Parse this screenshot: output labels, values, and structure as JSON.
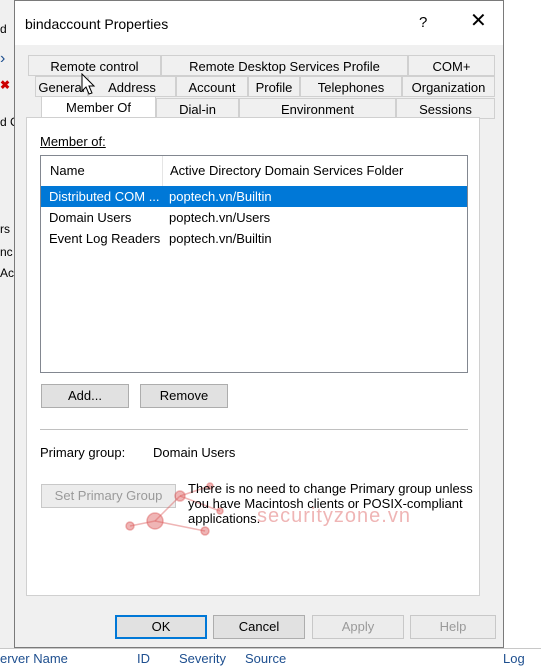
{
  "dialog": {
    "title": "bindaccount Properties",
    "help_glyph": "?",
    "close_glyph": "✕"
  },
  "tabs": {
    "row1": [
      "Remote control",
      "Remote Desktop Services Profile",
      "COM+"
    ],
    "row2": [
      "General",
      "Address",
      "Account",
      "Profile",
      "Telephones",
      "Organization"
    ],
    "row3": [
      "Member Of",
      "Dial-in",
      "Environment",
      "Sessions"
    ],
    "active": "Member Of"
  },
  "member_of": {
    "label": "Member of:",
    "columns": [
      "Name",
      "Active Directory Domain Services Folder"
    ],
    "rows": [
      {
        "name": "Distributed COM ...",
        "folder": "poptech.vn/Builtin",
        "selected": true
      },
      {
        "name": "Domain Users",
        "folder": "poptech.vn/Users",
        "selected": false
      },
      {
        "name": "Event Log Readers",
        "folder": "poptech.vn/Builtin",
        "selected": false
      }
    ]
  },
  "buttons": {
    "add": "Add...",
    "remove": "Remove",
    "set_primary": "Set Primary Group",
    "ok": "OK",
    "cancel": "Cancel",
    "apply": "Apply",
    "help": "Help"
  },
  "primary_group": {
    "label": "Primary group:",
    "value": "Domain Users"
  },
  "note": "There is no need to change Primary group unless you have Macintosh clients or POSIX-compliant applications.",
  "watermark": "securityzone.vn",
  "background": {
    "left_fragments": [
      "d",
      "d C",
      "rs",
      "nc",
      "Ac"
    ],
    "bottom_columns": [
      "erver Name",
      "ID",
      "Severity",
      "Source",
      "Log"
    ]
  },
  "colors": {
    "selection": "#0078d7",
    "watermark": "#dc5a5a"
  }
}
